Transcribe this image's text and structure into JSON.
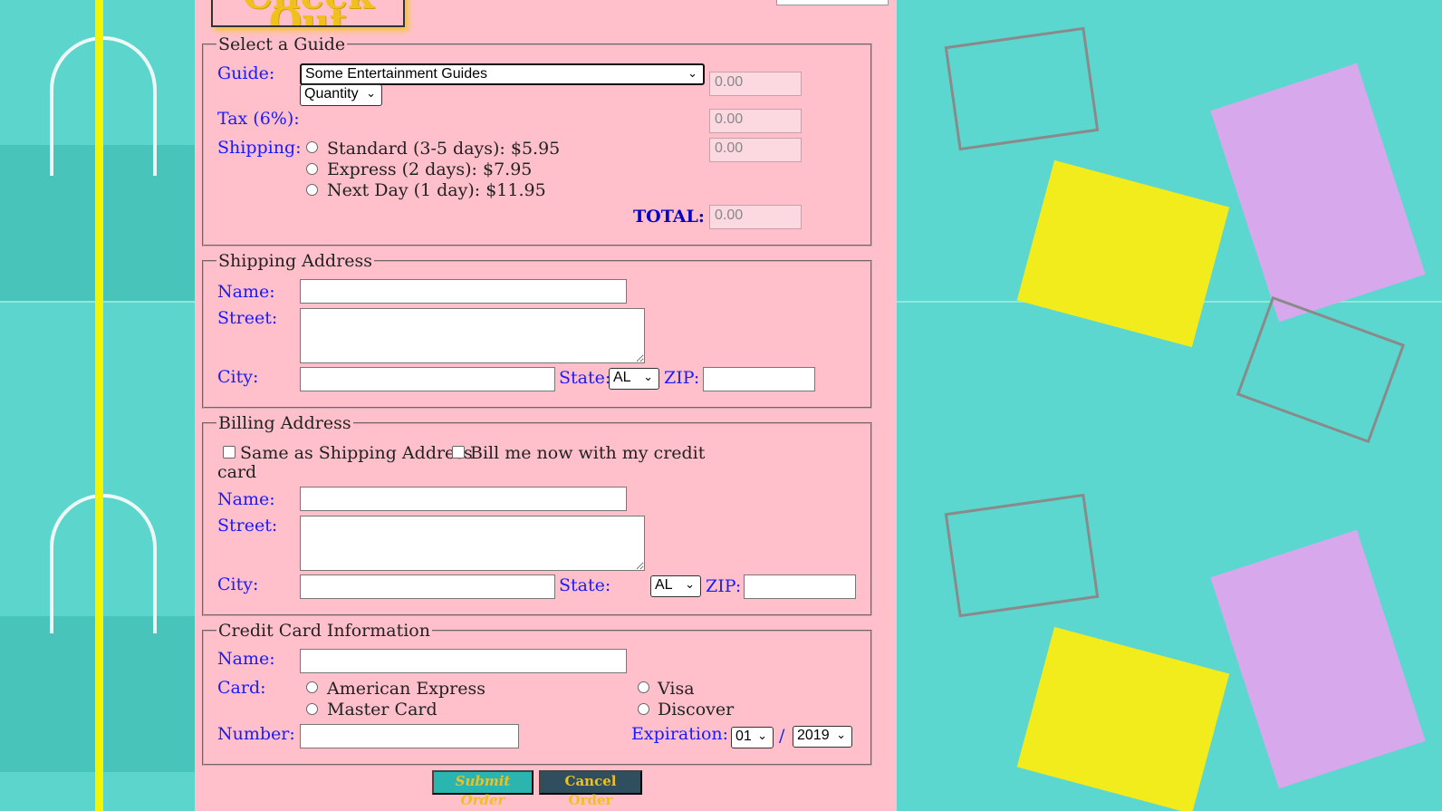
{
  "title": "Check Out",
  "guide_section": {
    "legend": "Select a Guide",
    "guide_label": "Guide:",
    "guide_value": "Some Entertainment Guides",
    "quantity_value": "Quantity",
    "subtotal_value": "0.00",
    "tax_label": "Tax (6%):",
    "tax_value": "0.00",
    "shipping_label": "Shipping:",
    "shipping_options": [
      "Standard (3-5 days): $5.95",
      "Express (2 days): $7.95",
      "Next Day (1 day): $11.95"
    ],
    "shipping_value": "0.00",
    "total_label": "TOTAL:",
    "total_value": "0.00"
  },
  "shipping_address": {
    "legend": "Shipping Address",
    "name_label": "Name:",
    "street_label": "Street:",
    "city_label": "City:",
    "state_label": "State:",
    "state_value": "AL",
    "zip_label": "ZIP:"
  },
  "billing_address": {
    "legend": "Billing Address",
    "same_as_shipping": "Same as Shipping Address",
    "bill_now_line1": "Bill me now with my credit",
    "bill_now_line2": "card",
    "name_label": "Name:",
    "street_label": "Street:",
    "city_label": "City:",
    "state_label": "State:",
    "state_value": "AL",
    "zip_label": "ZIP:"
  },
  "credit_card": {
    "legend": "Credit Card Information",
    "name_label": "Name:",
    "card_label": "Card:",
    "cards": [
      "American Express",
      "Master Card",
      "Visa",
      "Discover"
    ],
    "number_label": "Number:",
    "expiration_label": "Expiration:",
    "month_value": "01",
    "separator": "/",
    "year_value": "2019"
  },
  "buttons": {
    "submit": "Submit Order",
    "cancel": "Cancel Order"
  },
  "colors": {
    "panel_bg": "#ffc0cb",
    "label_blue": "#1a1aff",
    "background_teal": "#5fd8cf",
    "stripe_yellow": "#f4f400",
    "submit_bg": "#2bb5b0",
    "submit_text": "#f0c020",
    "cancel_bg": "#2f4f5f",
    "cancel_text": "#f0c020"
  }
}
